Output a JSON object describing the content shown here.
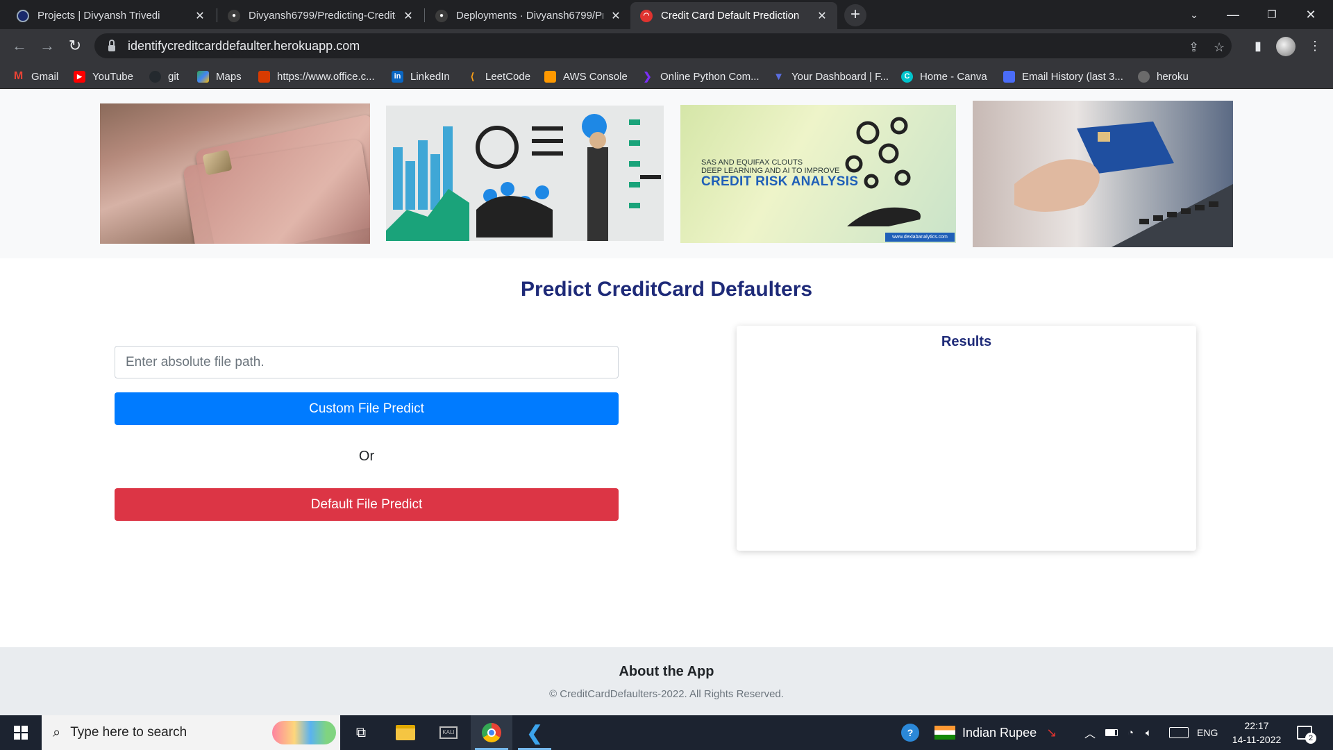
{
  "browser": {
    "tabs": [
      {
        "title": "Projects | Divyansh Trivedi",
        "icon": "portfolio-icon",
        "color": "#1a2a6c"
      },
      {
        "title": "Divyansh6799/Predicting-Credit-",
        "icon": "github-icon",
        "color": "#3c3c3c"
      },
      {
        "title": "Deployments · Divyansh6799/Pre",
        "icon": "github-icon",
        "color": "#3c3c3c"
      },
      {
        "title": "Credit Card Default Prediction",
        "icon": "site-icon",
        "color": "#e0332f"
      }
    ],
    "url": "identifycreditcarddefaulter.herokuapp.com",
    "bookmarks": [
      {
        "label": "Gmail",
        "icon": "gmail-icon",
        "color": "#ea4335"
      },
      {
        "label": "YouTube",
        "icon": "youtube-icon",
        "color": "#ff0000"
      },
      {
        "label": "git",
        "icon": "github-icon",
        "color": "#24292e"
      },
      {
        "label": "Maps",
        "icon": "maps-icon",
        "color": "#34a853"
      },
      {
        "label": "https://www.office.c...",
        "icon": "office-icon",
        "color": "#d83b01"
      },
      {
        "label": "LinkedIn",
        "icon": "linkedin-icon",
        "color": "#0a66c2"
      },
      {
        "label": "LeetCode",
        "icon": "leetcode-icon",
        "color": "#ffa116"
      },
      {
        "label": "AWS Console",
        "icon": "aws-icon",
        "color": "#ff9900"
      },
      {
        "label": "Online Python Com...",
        "icon": "python-compiler-icon",
        "color": "#7b2ff7"
      },
      {
        "label": "Your Dashboard | F...",
        "icon": "dashboard-icon",
        "color": "#5b6ee1"
      },
      {
        "label": "Home - Canva",
        "icon": "canva-icon",
        "color": "#00c4cc"
      },
      {
        "label": "Email History (last 3...",
        "icon": "email-history-icon",
        "color": "#4a6cf7"
      },
      {
        "label": "heroku",
        "icon": "heroku-icon",
        "color": "#6b6b6b"
      }
    ]
  },
  "banner": {
    "img3_line1": "SAS AND EQUIFAX CLOUTS",
    "img3_line2": "DEEP LEARNING AND AI TO IMPROVE",
    "img3_headline": "CREDIT RISK ANALYSIS",
    "img3_footer": "www.dexlabanalytics.com"
  },
  "page": {
    "title": "Predict CreditCard Defaulters",
    "file_input_placeholder": "Enter absolute file path.",
    "custom_button": "Custom File Predict",
    "or_text": "Or",
    "default_button": "Default File Predict",
    "results_title": "Results"
  },
  "footer": {
    "title": "About the App",
    "copyright": "© CreditCardDefaulters-2022. All Rights Reserved."
  },
  "taskbar": {
    "search_placeholder": "Type here to search",
    "currency_widget": "Indian Rupee",
    "language": "ENG",
    "time": "22:17",
    "date": "14-11-2022",
    "notification_count": "2"
  },
  "colors": {
    "title_navy": "#1e2a78",
    "primary_blue": "#007bff",
    "danger_red": "#dc3545"
  }
}
